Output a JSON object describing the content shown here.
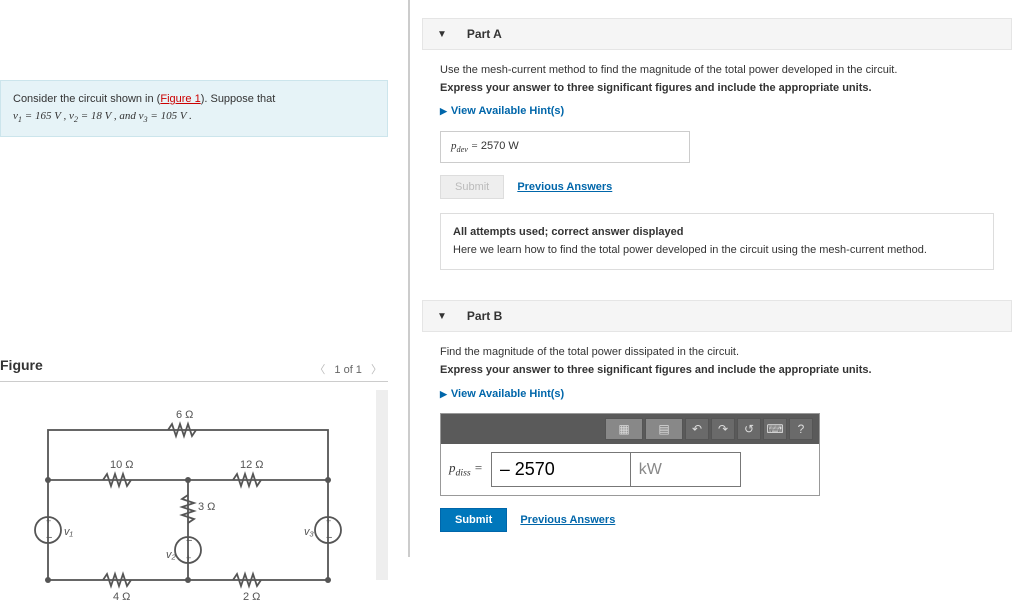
{
  "problem": {
    "prefix": "Consider the circuit shown in (",
    "figure_link": "Figure 1",
    "suffix": "). Suppose that",
    "line2_html": "v₁ = 165 V, v₂ = 18 V, and v₃ = 105 V."
  },
  "figure": {
    "title": "Figure",
    "pager": "1 of 1",
    "labels": {
      "r6": "6 Ω",
      "r10": "10 Ω",
      "r12": "12 Ω",
      "r3": "3 Ω",
      "r4": "4 Ω",
      "r2": "2 Ω",
      "v1": "v₁",
      "v2": "v₂",
      "v3": "v₃"
    }
  },
  "partA": {
    "title": "Part A",
    "instr1": "Use the mesh-current method to find the magnitude of the total power developed in the circuit.",
    "instr2": "Express your answer to three significant figures and include the appropriate units.",
    "hints": "View Available Hint(s)",
    "var_label": "pdev =",
    "value": "2570 W",
    "submit": "Submit",
    "prev": "Previous Answers",
    "feedback_title": "All attempts used; correct answer displayed",
    "feedback_body": "Here we learn how to find the total power developed in the circuit using the mesh-current method."
  },
  "partB": {
    "title": "Part B",
    "instr1": "Find the magnitude of the total power dissipated in the circuit.",
    "instr2": "Express your answer to three significant figures and include the appropriate units.",
    "hints": "View Available Hint(s)",
    "var_label": "pdiss =",
    "value": "– 2570",
    "unit": "kW",
    "submit": "Submit",
    "prev": "Previous Answers",
    "tools": {
      "undo": "↶",
      "redo": "↷",
      "reset": "↺",
      "kbd": "⌨",
      "help": "?"
    }
  }
}
